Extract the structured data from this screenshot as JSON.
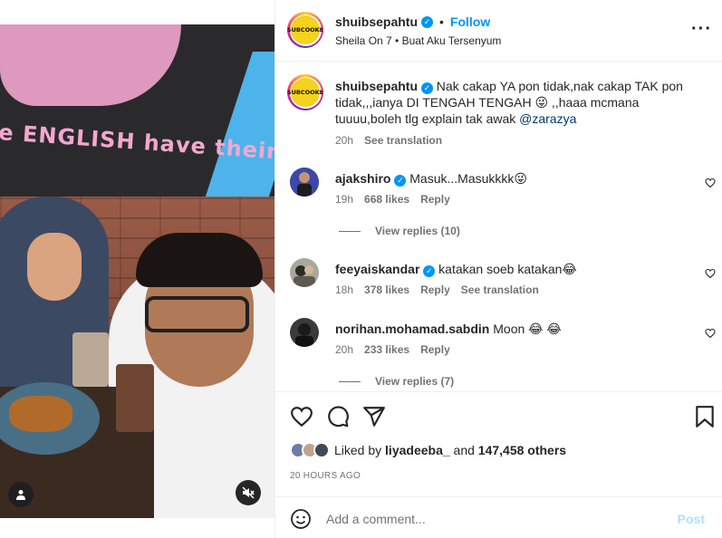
{
  "media": {
    "wall_text": "e ENGLISH have their TEA",
    "user_tag_icon": "person-icon",
    "mute_icon": "speaker-muted-icon"
  },
  "header": {
    "avatar_text": "SUBCOOKE",
    "username": "shuibsepahtu",
    "separator": "•",
    "follow_label": "Follow",
    "subtitle": "Sheila On 7 • Buat Aku Tersenyum",
    "more_icon": "more-options-icon"
  },
  "caption": {
    "avatar_text": "SUBCOOKE",
    "username": "shuibsepahtu",
    "text": " Nak cakap YA pon tidak,nak cakap TAK pon tidak,,,ianya DI TENGAH TENGAH 😜 ,,haaa mcmana tuuuu,boleh tlg explain tak awak ",
    "mention": "@zarazya",
    "time": "20h",
    "see_translation": "See translation"
  },
  "comments": [
    {
      "username": "ajakshiro",
      "verified": true,
      "text": " Masuk...Masukkkk😜",
      "time": "19h",
      "likes": "668 likes",
      "reply": "Reply",
      "view_replies": "View replies (10)",
      "avatar_color": "#3b4aa8"
    },
    {
      "username": "feeyaiskandar",
      "verified": true,
      "text": " katakan soeb katakan😂",
      "time": "18h",
      "likes": "378 likes",
      "reply": "Reply",
      "see_translation": "See translation",
      "avatar_color": "#8b8a7f"
    },
    {
      "username": "norihan.mohamad.sabdin",
      "verified": false,
      "text": " Moon 😂 😂",
      "time": "20h",
      "likes": "233 likes",
      "reply": "Reply",
      "view_replies": "View replies (7)",
      "avatar_color": "#2a2a2a"
    }
  ],
  "actions": {
    "like_icon": "heart-icon",
    "comment_icon": "comment-icon",
    "share_icon": "share-icon",
    "save_icon": "bookmark-icon"
  },
  "likes": {
    "prefix": "Liked by ",
    "user": "liyadeeba_",
    "middle": " and ",
    "others": "147,458 others"
  },
  "date": "20 HOURS AGO",
  "composer": {
    "placeholder": "Add a comment...",
    "post_label": "Post",
    "emoji_icon": "emoji-icon"
  },
  "colors": {
    "accent": "#0095f6",
    "post_disabled": "#b2dffc",
    "muted_text": "#737373"
  }
}
